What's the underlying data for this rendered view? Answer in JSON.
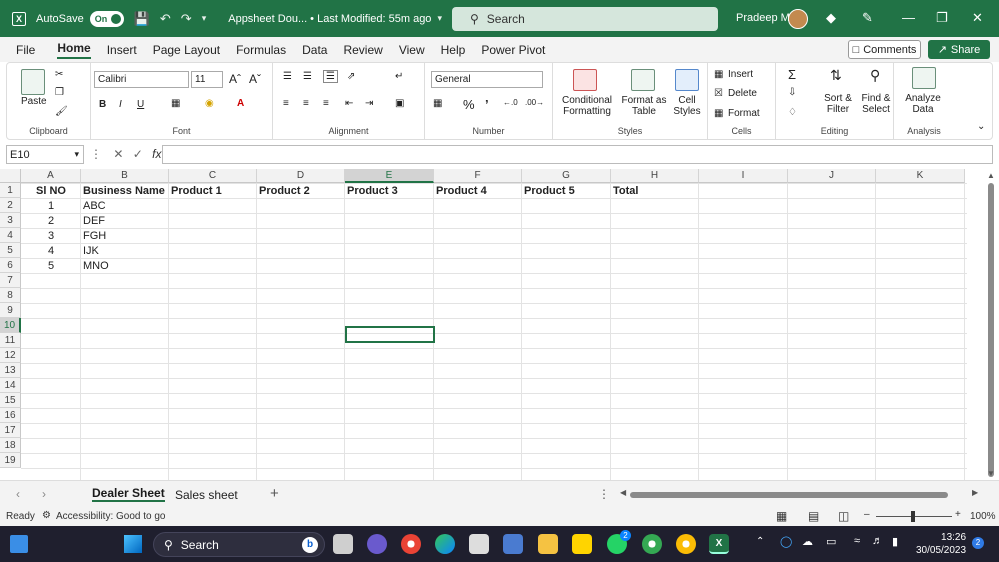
{
  "titlebar": {
    "autosave_label": "AutoSave",
    "toggle_label": "On",
    "doc_title": "Appsheet Dou...  •  Last Modified: 55m ago",
    "search_placeholder": "Search",
    "user_name": "Pradeep M"
  },
  "menu": {
    "tabs": [
      "File",
      "Home",
      "Insert",
      "Page Layout",
      "Formulas",
      "Data",
      "Review",
      "View",
      "Help",
      "Power Pivot"
    ],
    "active": "Home",
    "comments_label": "Comments",
    "share_label": "Share"
  },
  "ribbon": {
    "clipboard": {
      "label": "Clipboard",
      "paste": "Paste"
    },
    "font": {
      "label": "Font",
      "family": "Calibri",
      "size": "11"
    },
    "alignment": {
      "label": "Alignment"
    },
    "number": {
      "label": "Number",
      "format": "General"
    },
    "styles": {
      "label": "Styles",
      "conditional": "Conditional Formatting",
      "format_table": "Format as Table",
      "cell_styles": "Cell Styles"
    },
    "cells": {
      "label": "Cells",
      "insert": "Insert",
      "delete": "Delete",
      "format": "Format"
    },
    "editing": {
      "label": "Editing",
      "sort": "Sort & Filter",
      "find": "Find & Select"
    },
    "analysis": {
      "label": "Analysis",
      "analyze": "Analyze Data"
    }
  },
  "formula_bar": {
    "name_box": "E10",
    "content": ""
  },
  "grid": {
    "columns": [
      "A",
      "B",
      "C",
      "D",
      "E",
      "F",
      "G",
      "H",
      "I",
      "J",
      "K"
    ],
    "selected_column": "E",
    "rows": [
      "1",
      "2",
      "3",
      "4",
      "5",
      "6",
      "7",
      "8",
      "9",
      "10",
      "11",
      "12",
      "13",
      "14",
      "15",
      "16",
      "17",
      "18",
      "19"
    ],
    "selected_row": "10",
    "headers": [
      "Sl NO",
      "Business Name",
      "Product 1",
      "Product 2",
      "Product 3",
      "Product 4",
      "Product 5",
      "Total"
    ],
    "data": [
      {
        "sl": "1",
        "name": "ABC"
      },
      {
        "sl": "2",
        "name": "DEF"
      },
      {
        "sl": "3",
        "name": "FGH"
      },
      {
        "sl": "4",
        "name": "IJK"
      },
      {
        "sl": "5",
        "name": "MNO"
      }
    ]
  },
  "sheets": {
    "tabs": [
      "Dealer Sheet",
      "Sales sheet"
    ],
    "active": "Dealer Sheet"
  },
  "status": {
    "ready": "Ready",
    "accessibility": "Accessibility: Good to go",
    "zoom": "100%"
  },
  "taskbar": {
    "search_placeholder": "Search",
    "time": "13:26",
    "date": "30/05/2023",
    "whatsapp_badge": "2",
    "notif_badge": "2"
  },
  "colors": {
    "excel_green": "#217346"
  }
}
